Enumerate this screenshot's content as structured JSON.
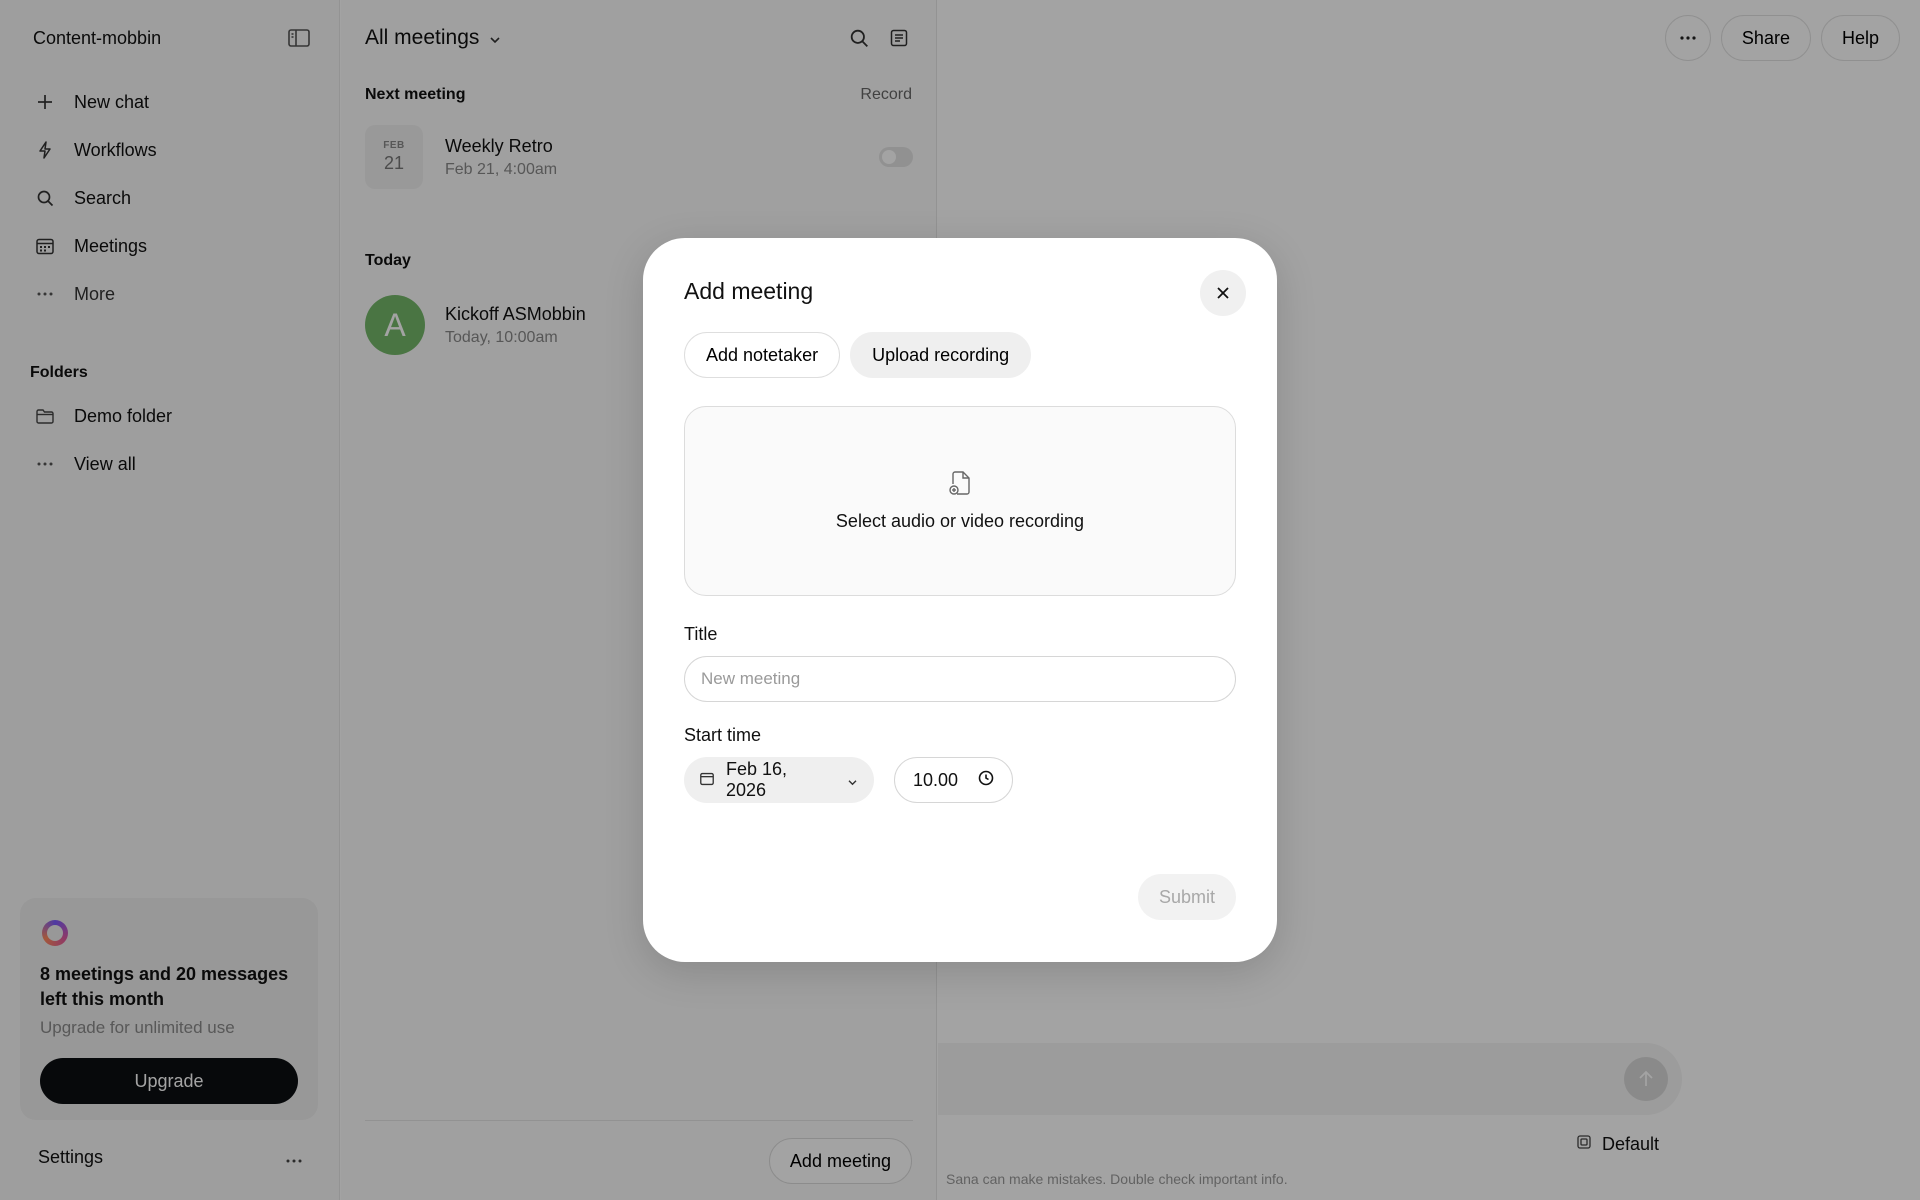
{
  "sidebar": {
    "workspace": "Content-mobbin",
    "toggle_icon": "sidebar-toggle-icon",
    "nav": [
      {
        "label": "New chat",
        "icon": "plus-icon"
      },
      {
        "label": "Workflows",
        "icon": "lightning-icon"
      },
      {
        "label": "Search",
        "icon": "search-icon"
      },
      {
        "label": "Meetings",
        "icon": "calendar-icon"
      },
      {
        "label": "More",
        "icon": "more-icon"
      }
    ],
    "folders_title": "Folders",
    "folders": [
      {
        "label": "Demo folder",
        "icon": "folder-icon"
      },
      {
        "label": "View all",
        "icon": "more-icon"
      }
    ],
    "promo": {
      "title": "8 meetings and 20 messages left this month",
      "subtitle": "Upgrade for unlimited use",
      "button": "Upgrade"
    },
    "settings_label": "Settings"
  },
  "meetings": {
    "title": "All meetings",
    "next_label": "Next meeting",
    "record_label": "Record",
    "next_meeting": {
      "month": "FEB",
      "day": "21",
      "name": "Weekly Retro",
      "when": "Feb 21, 4:00am"
    },
    "today_label": "Today",
    "today_meeting": {
      "avatar": "A",
      "name": "Kickoff ASMobbin",
      "when": "Today, 10:00am"
    },
    "add_button": "Add meeting"
  },
  "main": {
    "share": "Share",
    "help": "Help",
    "model": "Default",
    "disclaimer": "Sana can make mistakes. Double check important info."
  },
  "modal": {
    "title": "Add meeting",
    "tabs": [
      "Add notetaker",
      "Upload recording"
    ],
    "active_tab": "Upload recording",
    "dropzone_text": "Select audio or video recording",
    "title_label": "Title",
    "title_placeholder": "New meeting",
    "start_label": "Start time",
    "date": "Feb 16, 2026",
    "time": "10.00",
    "submit": "Submit"
  },
  "colors": {
    "accent_dark": "#0c0f12",
    "avatar_green": "#74b86a",
    "overlay": "rgba(0,0,0,0.36)"
  }
}
